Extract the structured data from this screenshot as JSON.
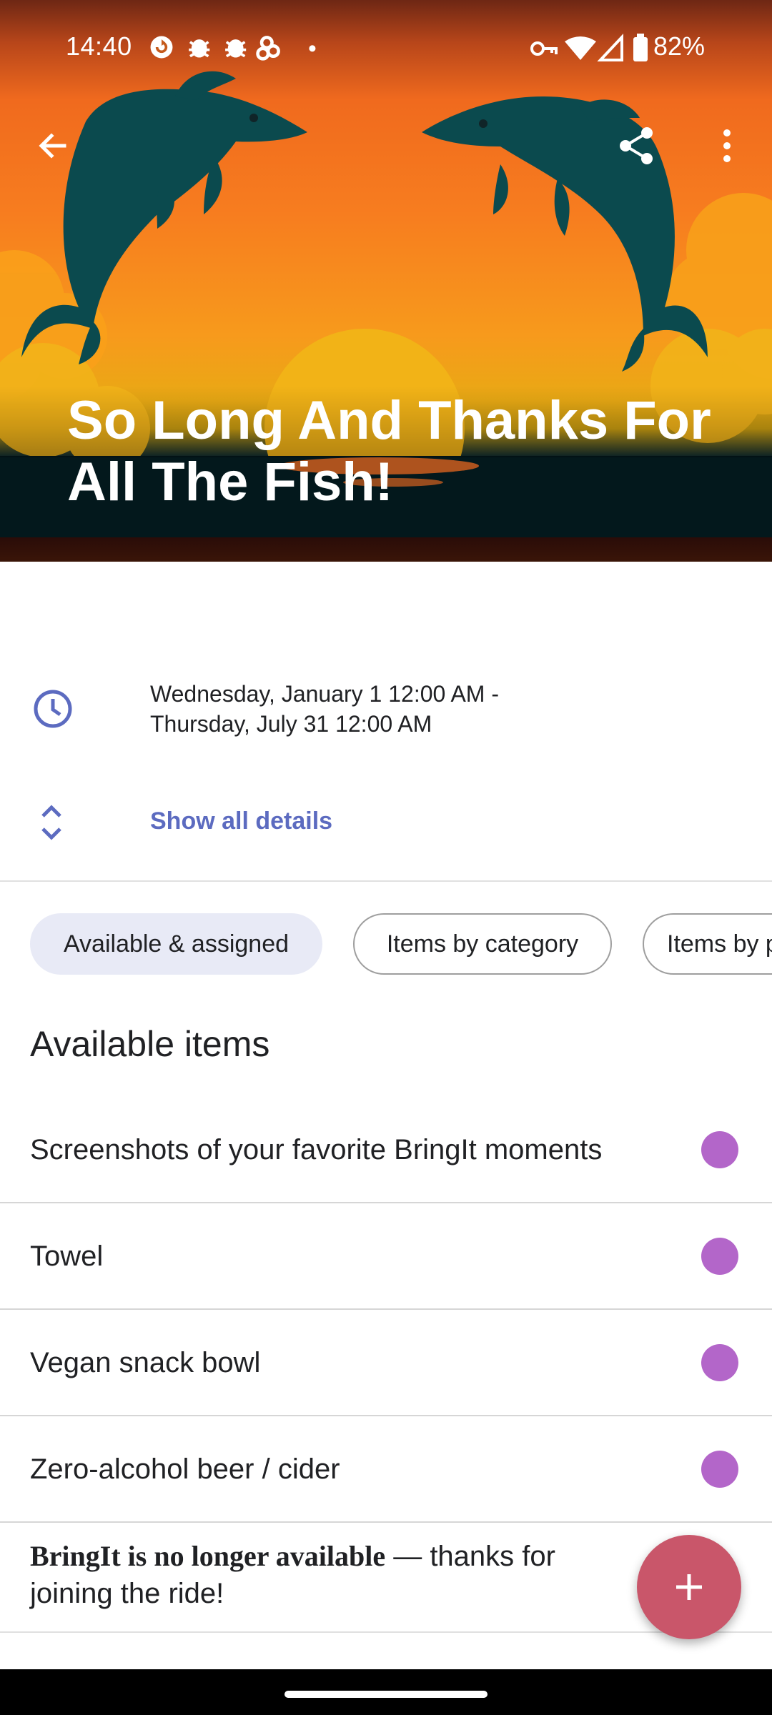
{
  "status_bar": {
    "time": "14:40",
    "battery_percent": "82%",
    "icons_left": [
      "sync-icon",
      "bug-icon",
      "bug-icon",
      "pinwheel-icon",
      "dot-icon"
    ],
    "icons_right": [
      "vpn-key-icon",
      "wifi-icon",
      "cell-signal-icon",
      "battery-icon"
    ]
  },
  "app_bar": {
    "back_icon": "arrow-back-icon",
    "share_icon": "share-icon",
    "menu_icon": "more-vert-icon"
  },
  "event": {
    "title": "So Long And Thanks For All The Fish!",
    "date_line_1": "Wednesday, January 1 12:00 AM -",
    "date_line_2": "Thursday, July 31 12:00 AM",
    "show_details_label": "Show all details"
  },
  "chips": [
    {
      "label": "Available & assigned",
      "selected": true
    },
    {
      "label": "Items by category",
      "selected": false
    },
    {
      "label": "Items by person",
      "selected": false
    }
  ],
  "list": {
    "section_title": "Available items",
    "items": [
      {
        "label": "Screenshots of your favorite BringIt moments"
      },
      {
        "label": "Towel"
      },
      {
        "label": "Vegan snack bowl"
      },
      {
        "label": "Zero-alcohol beer / cider"
      }
    ]
  },
  "banner": {
    "bold_text": "BringIt is no longer available",
    "rest_text": " — thanks for",
    "line2_text": "joining the ride!"
  },
  "fab": {
    "icon": "plus-icon"
  },
  "colors": {
    "accent": "#5c6bc0",
    "item_dot": "#b366c9",
    "fab": "#c9566a",
    "chip_selected": "#e8eaf6"
  }
}
